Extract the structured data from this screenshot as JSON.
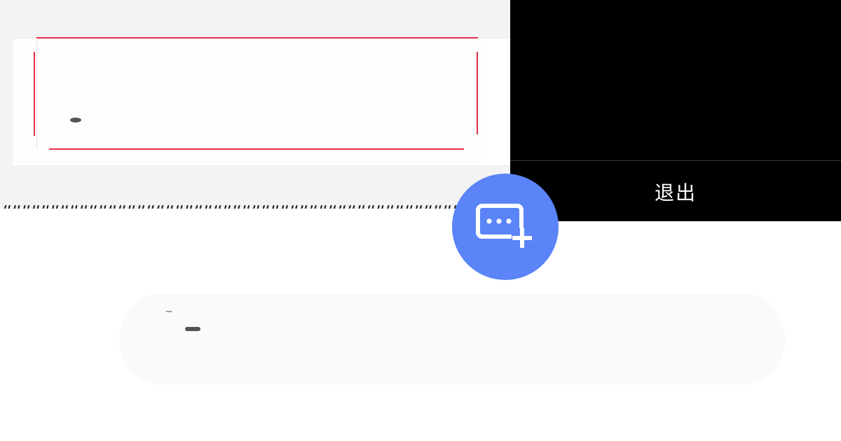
{
  "pattern": {
    "line_text": "###################################################:"
  },
  "exit_panel": {
    "label": "退出",
    "background": "#000000",
    "text_color": "#ffffff"
  },
  "frame": {
    "border_color": "#e2324a"
  },
  "fab": {
    "icon": "add-comment-icon",
    "color": "#5a84f7"
  }
}
